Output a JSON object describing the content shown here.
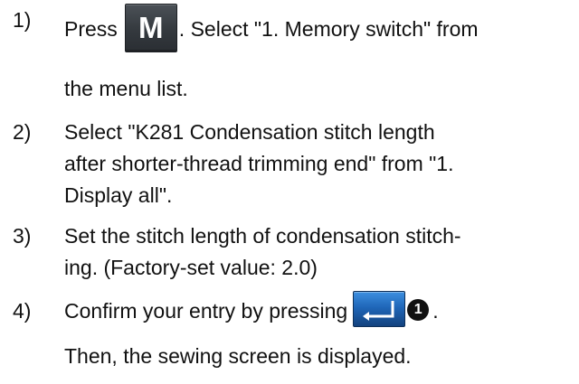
{
  "steps": [
    {
      "number": "1)",
      "prefix": "Press",
      "key_label": "M",
      "key_icon": "M-key-icon",
      "suffix": ". Select \"1. Memory switch\" from",
      "continuation": "the menu list."
    },
    {
      "number": "2)",
      "lines": [
        "Select \"K281 Condensation stitch length",
        "after shorter-thread trimming end\" from \"1.",
        "Display all\"."
      ]
    },
    {
      "number": "3)",
      "lines": [
        "Set the stitch length of condensation stitch-",
        "ing. (Factory-set value: 2.0)"
      ]
    },
    {
      "number": "4)",
      "prefix": "Confirm your entry by pressing",
      "key_icon": "enter-key-icon",
      "callout": "1",
      "suffix": ".",
      "continuation": "Then, the sewing screen is displayed."
    }
  ],
  "colors": {
    "text": "#111111",
    "m_key": "#3a3f44",
    "enter_key": "#1f66b8",
    "callout": "#111111"
  }
}
